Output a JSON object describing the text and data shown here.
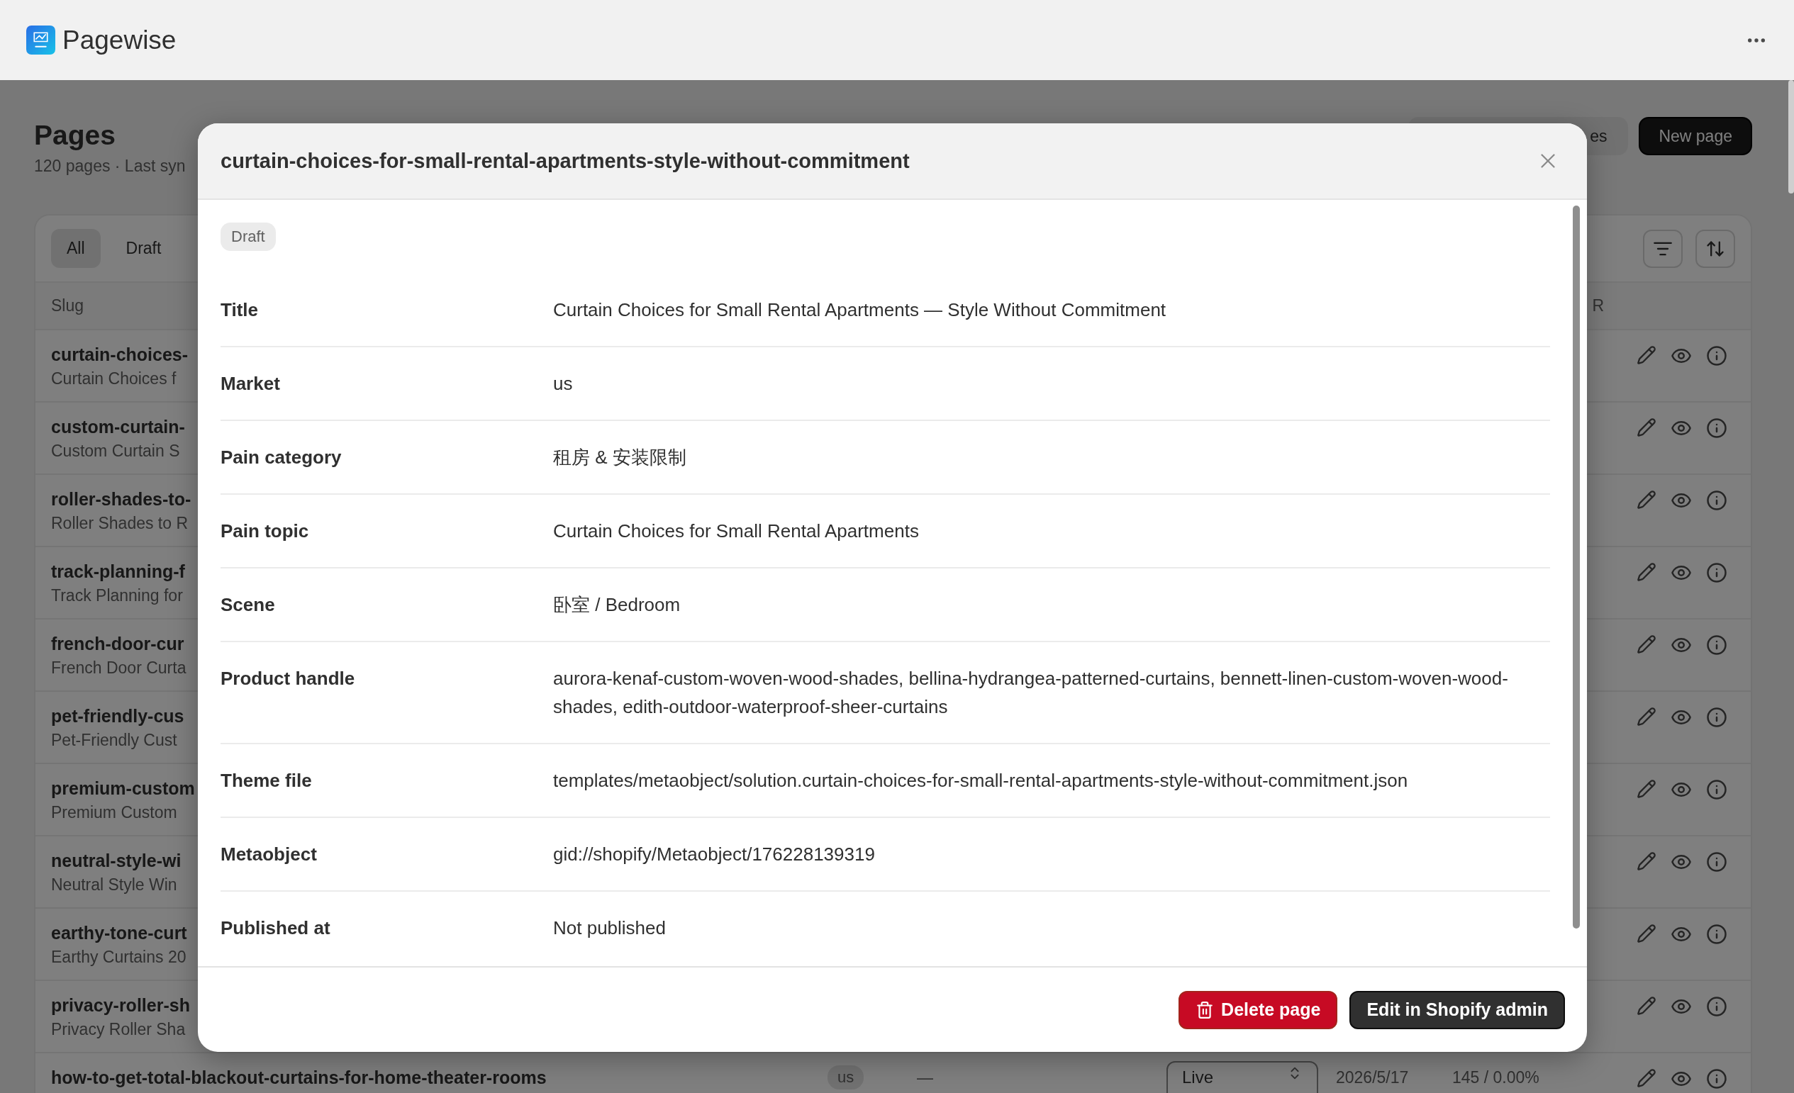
{
  "app": {
    "name": "Pagewise"
  },
  "page": {
    "title": "Pages",
    "subtitle": "120 pages · Last syn",
    "actions": [
      {
        "label": "es",
        "kind": "secondary"
      },
      {
        "label": "New page",
        "kind": "primary"
      }
    ],
    "tabs": [
      {
        "label": "All",
        "selected": true
      },
      {
        "label": "Draft",
        "selected": false
      }
    ],
    "table": {
      "columns": [
        "Slug",
        "R"
      ],
      "rows": [
        {
          "slug": "curtain-choices-",
          "title": "Curtain Choices f"
        },
        {
          "slug": "custom-curtain-",
          "title": "Custom Curtain S"
        },
        {
          "slug": "roller-shades-to-",
          "title": "Roller Shades to R"
        },
        {
          "slug": "track-planning-f",
          "title": "Track Planning for"
        },
        {
          "slug": "french-door-cur",
          "title": "French Door Curta"
        },
        {
          "slug": "pet-friendly-cus",
          "title": "Pet-Friendly Cust"
        },
        {
          "slug": "premium-custom",
          "title": "Premium Custom"
        },
        {
          "slug": "neutral-style-wi",
          "title": "Neutral Style Win"
        },
        {
          "slug": "earthy-tone-curt",
          "title": "Earthy Curtains 20"
        },
        {
          "slug": "privacy-roller-sh",
          "title": "Privacy Roller Sha"
        },
        {
          "slug": "how-to-get-total-blackout-curtains-for-home-theater-rooms",
          "market": "us",
          "column_3": "—",
          "status": "Live",
          "date": "2026/5/17",
          "views": "145 / 0.00%"
        }
      ]
    }
  },
  "dialog": {
    "title": "curtain-choices-for-small-rental-apartments-style-without-commitment",
    "status": "Draft",
    "fields": [
      {
        "label": "Title",
        "value": "Curtain Choices for Small Rental Apartments — Style Without Commitment"
      },
      {
        "label": "Market",
        "value": "us"
      },
      {
        "label": "Pain category",
        "value": "租房 & 安装限制"
      },
      {
        "label": "Pain topic",
        "value": "Curtain Choices for Small Rental Apartments"
      },
      {
        "label": "Scene",
        "value": "卧室 / Bedroom"
      },
      {
        "label": "Product handle",
        "value": "aurora-kenaf-custom-woven-wood-shades, bellina-hydrangea-patterned-curtains, bennett-linen-custom-woven-wood-shades, edith-outdoor-waterproof-sheer-curtains"
      },
      {
        "label": "Theme file",
        "value": "templates/metaobject/solution.curtain-choices-for-small-rental-apartments-style-without-commitment.json"
      },
      {
        "label": "Metaobject",
        "value": "gid://shopify/Metaobject/176228139319"
      },
      {
        "label": "Published at",
        "value": "Not published"
      }
    ],
    "actions": [
      {
        "label": "Delete page",
        "kind": "destructive"
      },
      {
        "label": "Edit in Shopify admin",
        "kind": "primary"
      }
    ]
  }
}
